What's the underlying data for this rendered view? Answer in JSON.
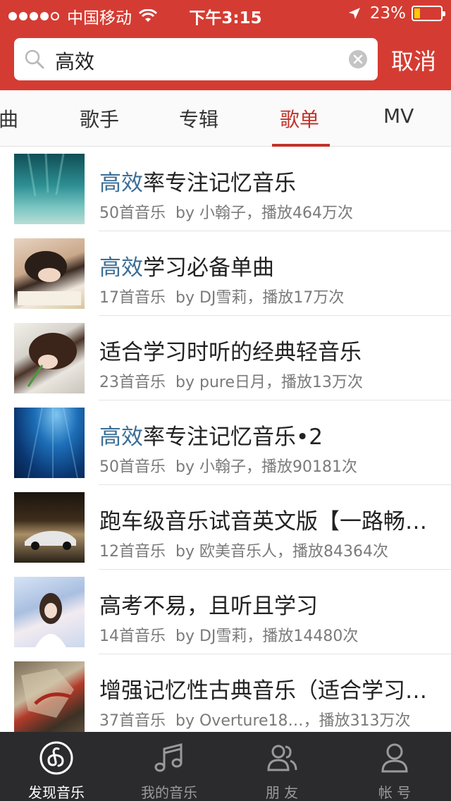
{
  "status_bar": {
    "carrier": "中国移动",
    "time": "下午3:15",
    "battery": "23%",
    "battery_level": 0.23
  },
  "search": {
    "query": "高效",
    "cancel_label": "取消"
  },
  "tabs": [
    {
      "label": "曲",
      "active": false
    },
    {
      "label": "歌手",
      "active": false
    },
    {
      "label": "专辑",
      "active": false
    },
    {
      "label": "歌单",
      "active": true
    },
    {
      "label": "MV",
      "active": false
    }
  ],
  "results": [
    {
      "title_hl": "高效",
      "title_rest": "率专注记忆音乐",
      "count": "50首音乐",
      "by": "by 小翰子",
      "plays": "，播放464万次"
    },
    {
      "title_hl": "高效",
      "title_rest": "学习必备单曲",
      "count": "17首音乐",
      "by": "by DJ雪莉",
      "plays": "，播放17万次"
    },
    {
      "title_hl": "",
      "title_rest": "适合学习时听的经典轻音乐",
      "count": "23首音乐",
      "by": "by pure日月",
      "plays": "，播放13万次"
    },
    {
      "title_hl": "高效",
      "title_rest": "率专注记忆音乐•2",
      "count": "50首音乐",
      "by": "by 小翰子",
      "plays": "，播放90181次"
    },
    {
      "title_hl": "",
      "title_rest": "跑车级音乐试音英文版【一路畅…",
      "count": "12首音乐",
      "by": "by 欧美音乐人",
      "plays": "，播放84364次"
    },
    {
      "title_hl": "",
      "title_rest": "高考不易，且听且学习",
      "count": "14首音乐",
      "by": "by DJ雪莉",
      "plays": "，播放14480次"
    },
    {
      "title_hl": "",
      "title_rest": "增强记忆性古典音乐（适合学习…",
      "count": "37首音乐",
      "by": "by Overture18…",
      "plays": "，播放313万次"
    }
  ],
  "tabbar": [
    {
      "label": "发现音乐",
      "icon": "netease-music-icon",
      "active": true
    },
    {
      "label": "我的音乐",
      "icon": "music-note-icon",
      "active": false
    },
    {
      "label": "朋 友",
      "icon": "friends-icon",
      "active": false
    },
    {
      "label": "帐 号",
      "icon": "account-icon",
      "active": false
    }
  ],
  "colors": {
    "brand_red": "#d43c33",
    "highlight_blue": "#3c6e95",
    "active_tab": "#c1332b",
    "tabbar_bg": "#2b2b2d"
  }
}
